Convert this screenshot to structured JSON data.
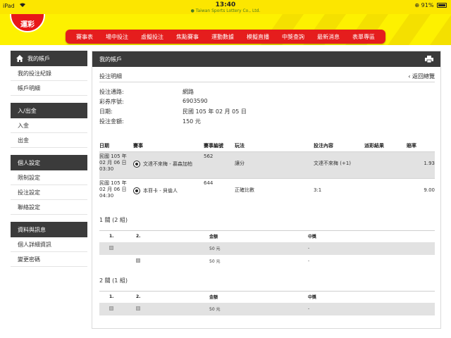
{
  "statusbar": {
    "device": "iPad",
    "time": "13:40",
    "url": "Taiwan Sports Lottery Co., Ltd.",
    "battery": "91%",
    "battery_level": 0.91
  },
  "logo_text": "運彩",
  "nav": [
    "賽事表",
    "場中投注",
    "虛擬投注",
    "焦點賽事",
    "運動數據",
    "模擬直播",
    "中獎查詢",
    "最新消息",
    "表單專區"
  ],
  "sidebar": {
    "account_title": "我的帳戶",
    "account_links": [
      "我的投注紀錄",
      "帳戶明細"
    ],
    "funds_title": "入/出金",
    "funds_links": [
      "入金",
      "出金"
    ],
    "settings_title": "個人設定",
    "settings_links": [
      "限制設定",
      "投注設定",
      "聯絡設定"
    ],
    "info_title": "資料與訊息",
    "info_links": [
      "個人詳細資訊",
      "變更密碼"
    ]
  },
  "panel": {
    "title": "我的帳戶",
    "section": "投注明細",
    "back": "‹ 返回總覽",
    "info": [
      {
        "label": "投注通路:",
        "value": "網路"
      },
      {
        "label": "彩券序號:",
        "value": "6903590"
      },
      {
        "label": "日期:",
        "value": "民國 105 年 02 月 05 日"
      },
      {
        "label": "投注金額:",
        "value": "150 元"
      }
    ],
    "bet_headers": [
      "日期",
      "賽事",
      "賽事編號",
      "玩法",
      "投注內容",
      "派彩結果",
      "賠率"
    ],
    "bets": [
      {
        "date1": "民國 105 年",
        "date2": "02 月 06 日",
        "date3": "03:30",
        "match": "文達不來梅 - 慕森加柏",
        "id": "562",
        "play": "讓分",
        "content": "文達不來梅 (+1)",
        "result": "",
        "odds": "1.93"
      },
      {
        "date1": "民國 105 年",
        "date2": "02 月 06 日",
        "date3": "04:30",
        "match": "本菲卡 - 貝倫人",
        "id": "644",
        "play": "正確比數",
        "content": "3:1",
        "result": "",
        "odds": "9.00"
      }
    ],
    "combos": [
      {
        "title": "1 關 (2 組)",
        "headers": [
          "1.",
          "2.",
          "金額",
          "中獎"
        ],
        "rows": [
          {
            "c1": true,
            "c2": false,
            "amount": "50 元",
            "win": "-"
          },
          {
            "c1": false,
            "c2": true,
            "amount": "50 元",
            "win": "-"
          }
        ]
      },
      {
        "title": "2 關 (1 組)",
        "headers": [
          "1.",
          "2.",
          "金額",
          "中獎"
        ],
        "rows": [
          {
            "c1": true,
            "c2": true,
            "amount": "50 元",
            "win": "-"
          }
        ]
      }
    ]
  }
}
